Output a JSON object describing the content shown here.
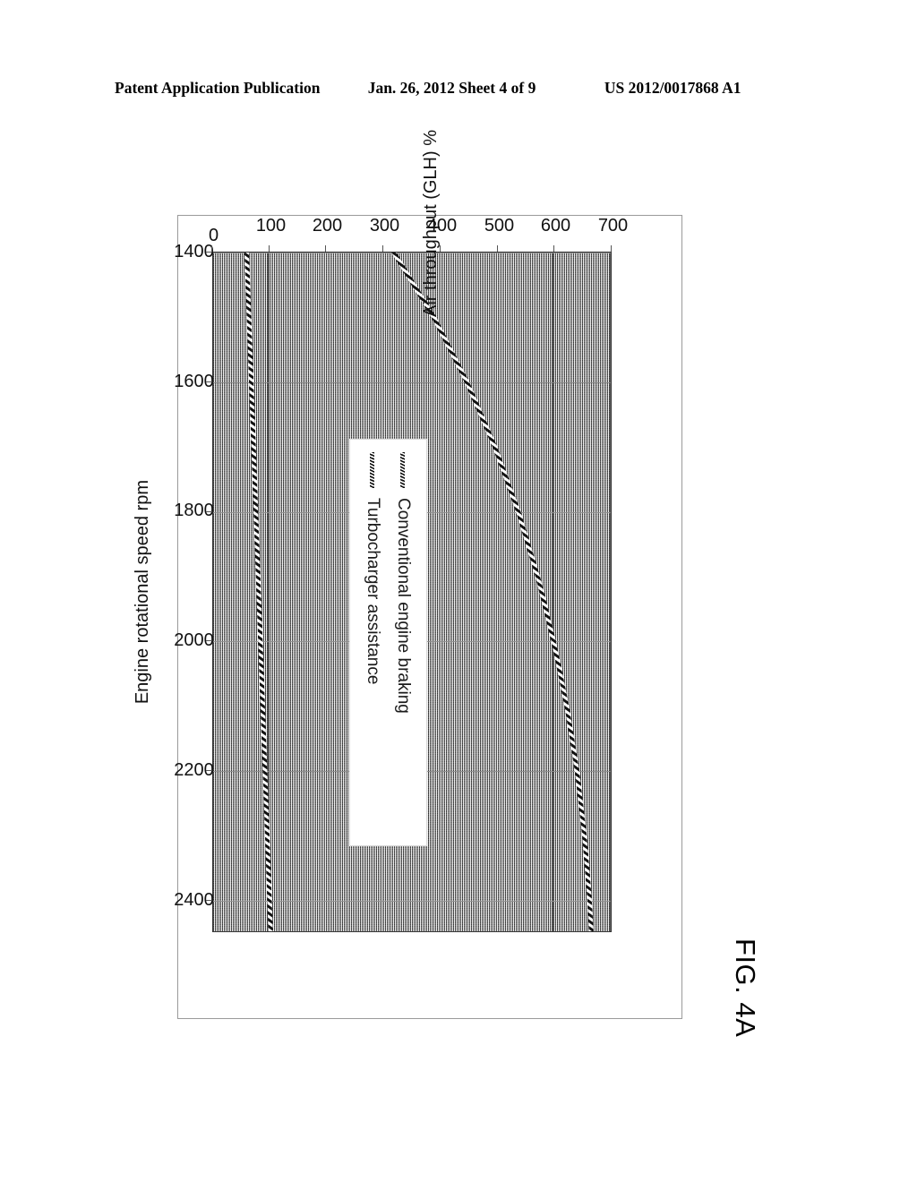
{
  "header": {
    "publication": "Patent Application Publication",
    "date_sheet": "Jan. 26, 2012  Sheet 4 of 9",
    "patent_number": "US 2012/0017868 A1"
  },
  "figure": {
    "caption": "FIG. 4A"
  },
  "chart_data": {
    "type": "line",
    "title": "",
    "xlabel": "Engine rotational speed rpm",
    "ylabel": "Air throughput (GLH) %",
    "xlim": [
      1400,
      2450
    ],
    "ylim": [
      0,
      700
    ],
    "xticks": [
      "1400",
      "1600",
      "1800",
      "2000",
      "2200",
      "2400"
    ],
    "xtick_values": [
      1400,
      1600,
      1800,
      2000,
      2200,
      2400
    ],
    "yticks": [
      "0",
      "100",
      "200",
      "300",
      "400",
      "500",
      "600",
      "700"
    ],
    "ytick_values": [
      0,
      100,
      200,
      300,
      400,
      500,
      600,
      700
    ],
    "grid": true,
    "legend_position": "upper center",
    "plot_background": "#bdbdbd",
    "series": [
      {
        "name": "Conventional engine braking",
        "color": "#1a1a1a",
        "x": [
          1400,
          1500,
          1600,
          1700,
          1800,
          1900,
          2000,
          2100,
          2200,
          2300,
          2400,
          2450
        ],
        "values": [
          62,
          66,
          70,
          74,
          78,
          82,
          86,
          90,
          94,
          98,
          102,
          104
        ]
      },
      {
        "name": "Turbocharger assistance",
        "color": "#1a1a1a",
        "x": [
          1400,
          1500,
          1600,
          1700,
          1800,
          1900,
          2000,
          2100,
          2200,
          2300,
          2400,
          2450
        ],
        "values": [
          320,
          390,
          448,
          497,
          538,
          572,
          600,
          623,
          641,
          654,
          663,
          666
        ]
      }
    ]
  }
}
